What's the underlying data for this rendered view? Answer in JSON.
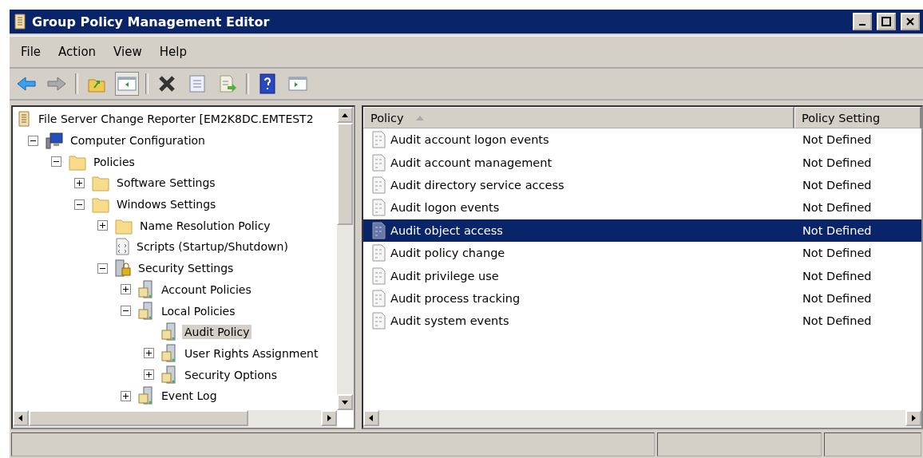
{
  "window": {
    "title": "Group Policy Management Editor"
  },
  "menu": [
    "File",
    "Action",
    "View",
    "Help"
  ],
  "tree": [
    {
      "label": "File Server Change Reporter [EM2K8DC.EMTEST2",
      "kind": "scroll",
      "selected": false,
      "children": [
        {
          "label": "Computer Configuration",
          "kind": "computer",
          "expanded": true,
          "selected": false,
          "children": [
            {
              "label": "Policies",
              "kind": "folder",
              "expanded": true,
              "selected": false,
              "children": [
                {
                  "label": "Software Settings",
                  "kind": "folder",
                  "expanded": false,
                  "selected": false
                },
                {
                  "label": "Windows Settings",
                  "kind": "folder",
                  "expanded": true,
                  "selected": false,
                  "children": [
                    {
                      "label": "Name Resolution Policy",
                      "kind": "folder",
                      "expanded": false,
                      "selected": false
                    },
                    {
                      "label": "Scripts (Startup/Shutdown)",
                      "kind": "script",
                      "selected": false
                    },
                    {
                      "label": "Security Settings",
                      "kind": "security",
                      "expanded": true,
                      "selected": false,
                      "children": [
                        {
                          "label": "Account Policies",
                          "kind": "server",
                          "expanded": false,
                          "selected": false
                        },
                        {
                          "label": "Local Policies",
                          "kind": "server",
                          "expanded": true,
                          "selected": false,
                          "children": [
                            {
                              "label": "Audit Policy",
                              "kind": "server",
                              "selected": true
                            },
                            {
                              "label": "User Rights Assignment",
                              "kind": "server",
                              "expanded": false,
                              "selected": false
                            },
                            {
                              "label": "Security Options",
                              "kind": "server",
                              "expanded": false,
                              "selected": false
                            }
                          ]
                        },
                        {
                          "label": "Event Log",
                          "kind": "server",
                          "expanded": false,
                          "selected": false
                        }
                      ]
                    }
                  ]
                }
              ]
            }
          ]
        }
      ]
    }
  ],
  "table": {
    "columns": [
      {
        "label": "Policy",
        "sorted": true
      },
      {
        "label": "Policy Setting",
        "sorted": false
      }
    ],
    "rows": [
      {
        "policy": "Audit account logon events",
        "setting": "Not Defined",
        "selected": false
      },
      {
        "policy": "Audit account management",
        "setting": "Not Defined",
        "selected": false
      },
      {
        "policy": "Audit directory service access",
        "setting": "Not Defined",
        "selected": false
      },
      {
        "policy": "Audit logon events",
        "setting": "Not Defined",
        "selected": false
      },
      {
        "policy": "Audit object access",
        "setting": "Not Defined",
        "selected": true
      },
      {
        "policy": "Audit policy change",
        "setting": "Not Defined",
        "selected": false
      },
      {
        "policy": "Audit privilege use",
        "setting": "Not Defined",
        "selected": false
      },
      {
        "policy": "Audit process tracking",
        "setting": "Not Defined",
        "selected": false
      },
      {
        "policy": "Audit system events",
        "setting": "Not Defined",
        "selected": false
      }
    ]
  }
}
